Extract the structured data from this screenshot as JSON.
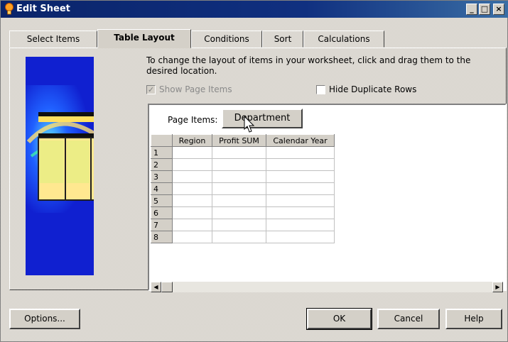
{
  "window": {
    "title": "Edit Sheet"
  },
  "titlebar_buttons": {
    "minimize": "_",
    "maximize": "□",
    "close": "×"
  },
  "tabs": [
    {
      "label": "Select Items"
    },
    {
      "label": "Table Layout"
    },
    {
      "label": "Conditions"
    },
    {
      "label": "Sort"
    },
    {
      "label": "Calculations"
    }
  ],
  "instructions": "To change the layout of items in your worksheet, click and drag them to the desired location.",
  "show_page_items": {
    "label": "Show Page Items",
    "checked": true,
    "disabled": true
  },
  "hide_duplicate_rows": {
    "label": "Hide Duplicate Rows",
    "checked": false
  },
  "page_items": {
    "label": "Page Items:",
    "item": "Department"
  },
  "grid": {
    "columns": [
      "Region",
      "Profit SUM",
      "Calendar Year"
    ],
    "rows": [
      "1",
      "2",
      "3",
      "4",
      "5",
      "6",
      "7",
      "8"
    ]
  },
  "buttons": {
    "options": "Options...",
    "ok": "OK",
    "cancel": "Cancel",
    "help": "Help"
  },
  "colors": {
    "title_bar": "#0a246a",
    "panel_bg": "#d4d0c8",
    "art_blue": "#1020d0"
  }
}
